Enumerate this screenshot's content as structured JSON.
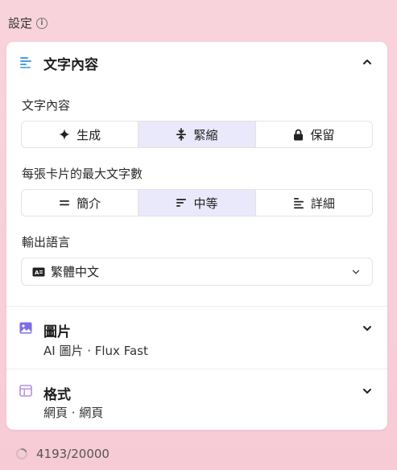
{
  "header": {
    "title": "設定"
  },
  "text_section": {
    "title": "文字內容",
    "content_label": "文字內容",
    "content_options": [
      "生成",
      "緊縮",
      "保留"
    ],
    "content_selected": "緊縮",
    "length_label": "每張卡片的最大文字數",
    "length_options": [
      "簡介",
      "中等",
      "詳細"
    ],
    "length_selected": "中等",
    "language_label": "輸出語言",
    "language_value": "繁體中文"
  },
  "image_section": {
    "title": "圖片",
    "summary": "AI 圖片 · Flux Fast"
  },
  "format_section": {
    "title": "格式",
    "summary": "網頁 · 網頁"
  },
  "footer": {
    "count": "4193/20000"
  },
  "colors": {
    "accent": "#6c5ce7",
    "active_bg": "#eae8fb",
    "icon_blue": "#4b9fe0",
    "icon_purple": "#7b6ee6"
  }
}
